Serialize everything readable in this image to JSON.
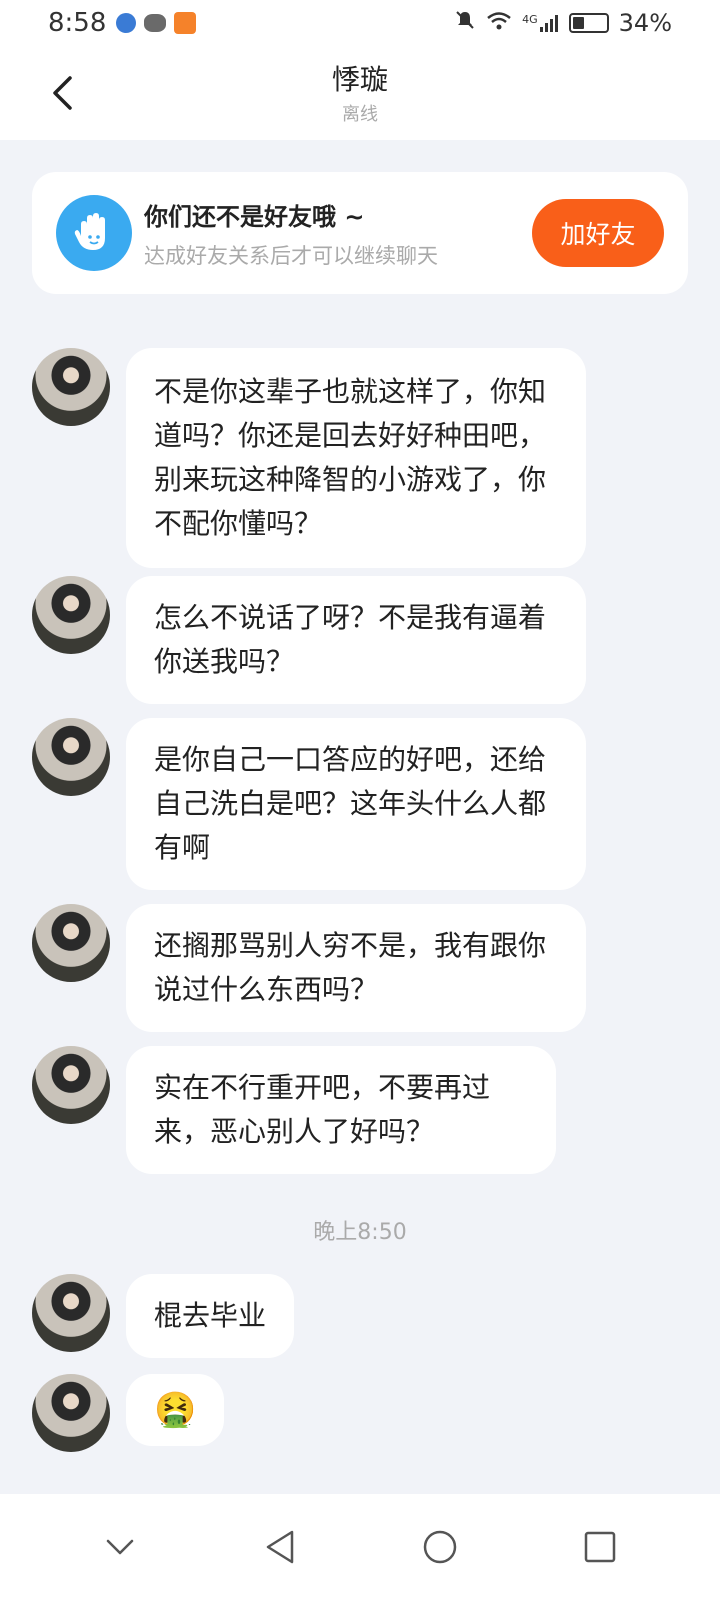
{
  "status_bar": {
    "time": "8:58",
    "network": "4G",
    "battery": "34%",
    "battery_level": 0.34
  },
  "header": {
    "back_icon": "chevron-left-icon",
    "contact_name": "悸璇",
    "presence": "离线"
  },
  "friend_banner": {
    "icon": "hand-wave-icon",
    "title": "你们还不是好友哦 ~",
    "subtitle": "达成好友关系后才可以继续聊天",
    "add_button": "加好友",
    "accent_color": "#f95f19"
  },
  "messages": [
    {
      "text": "不是你这辈子也就这样了，你知道吗？你还是回去好好种田吧，别来玩这种降智的小游戏了，你不配你懂吗？"
    },
    {
      "text": "怎么不说话了呀？不是我有逼着你送我吗？"
    },
    {
      "text": "是你自己一口答应的好吧，还给自己洗白是吧？这年头什么人都有啊"
    },
    {
      "text": "还搁那骂别人穷不是，我有跟你说过什么东西吗？"
    },
    {
      "text": "实在不行重开吧，不要再过来，恶心别人了好吗？"
    },
    {
      "text": "棍去毕业"
    },
    {
      "text": "🤮"
    }
  ],
  "time_separator": "晚上8:50",
  "nav_bar": {
    "buttons": [
      "chevron-down-icon",
      "back-triangle-icon",
      "home-circle-icon",
      "recents-square-icon"
    ]
  }
}
